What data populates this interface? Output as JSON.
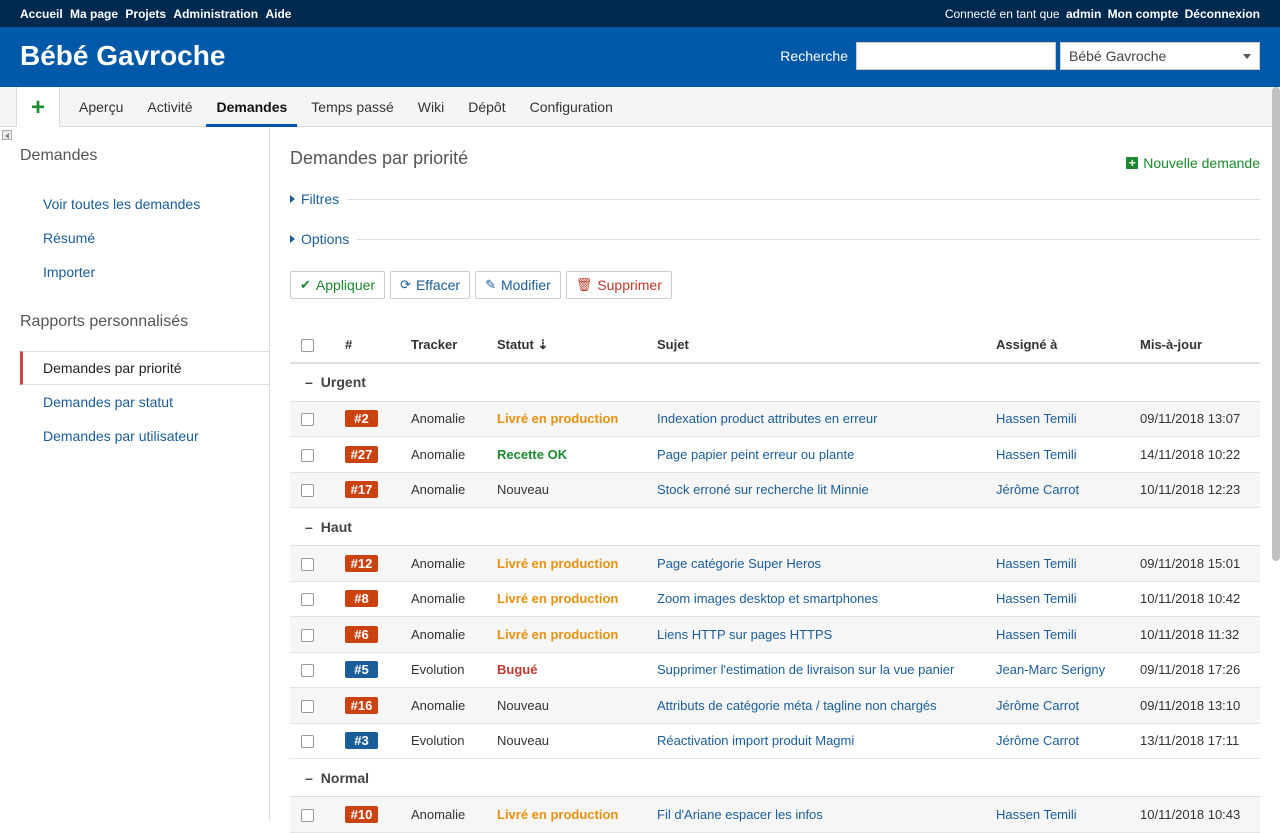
{
  "top_menu": {
    "links": [
      "Accueil",
      "Ma page",
      "Projets",
      "Administration",
      "Aide"
    ],
    "logged_as_label": "Connecté en tant que",
    "user": "admin",
    "account": "Mon compte",
    "logout": "Déconnexion"
  },
  "header": {
    "title": "Bébé Gavroche",
    "search_label": "Recherche",
    "search_value": "",
    "project_select": "Bébé Gavroche"
  },
  "main_menu": {
    "new_label": "+",
    "tabs": [
      "Aperçu",
      "Activité",
      "Demandes",
      "Temps passé",
      "Wiki",
      "Dépôt",
      "Configuration"
    ],
    "selected": "Demandes"
  },
  "sidebar": {
    "title": "Demandes",
    "links": [
      "Voir toutes les demandes",
      "Résumé",
      "Importer"
    ],
    "reports_title": "Rapports personnalisés",
    "queries": [
      "Demandes par priorité",
      "Demandes par statut",
      "Demandes par utilisateur"
    ],
    "active_query": "Demandes par priorité"
  },
  "content": {
    "title": "Demandes par priorité",
    "new_issue": "Nouvelle demande",
    "filters": "Filtres",
    "options": "Options",
    "buttons": {
      "apply": "Appliquer",
      "clear": "Effacer",
      "modify": "Modifier",
      "delete": "Supprimer"
    }
  },
  "table": {
    "columns": [
      "#",
      "Tracker",
      "Statut",
      "Sujet",
      "Assigné à",
      "Mis-à-jour"
    ],
    "groups": [
      {
        "name": "Urgent",
        "rows": [
          {
            "id": "#2",
            "tracker": "Anomalie",
            "status": "Livré en production",
            "subject": "Indexation product attributes en erreur",
            "assigned": "Hassen Temili",
            "updated": "09/11/2018 13:07"
          },
          {
            "id": "#27",
            "tracker": "Anomalie",
            "status": "Recette OK",
            "subject": "Page papier peint erreur ou plante",
            "assigned": "Hassen Temili",
            "updated": "14/11/2018 10:22"
          },
          {
            "id": "#17",
            "tracker": "Anomalie",
            "status": "Nouveau",
            "subject": "Stock erroné sur recherche lit Minnie",
            "assigned": "Jérôme Carrot",
            "updated": "10/11/2018 12:23"
          }
        ]
      },
      {
        "name": "Haut",
        "rows": [
          {
            "id": "#12",
            "tracker": "Anomalie",
            "status": "Livré en production",
            "subject": "Page catégorie Super Heros",
            "assigned": "Hassen Temili",
            "updated": "09/11/2018 15:01"
          },
          {
            "id": "#8",
            "tracker": "Anomalie",
            "status": "Livré en production",
            "subject": "Zoom images desktop et smartphones",
            "assigned": "Hassen Temili",
            "updated": "10/11/2018 10:42"
          },
          {
            "id": "#6",
            "tracker": "Anomalie",
            "status": "Livré en production",
            "subject": "Liens HTTP sur pages HTTPS",
            "assigned": "Hassen Temili",
            "updated": "10/11/2018 11:32"
          },
          {
            "id": "#5",
            "tracker": "Evolution",
            "status": "Bugué",
            "subject": "Supprimer l'estimation de livraison sur la vue panier",
            "assigned": "Jean-Marc Serigny",
            "updated": "09/11/2018 17:26"
          },
          {
            "id": "#16",
            "tracker": "Anomalie",
            "status": "Nouveau",
            "subject": "Attributs de catégorie méta / tagline non chargés",
            "assigned": "Jérôme Carrot",
            "updated": "09/11/2018 13:10"
          },
          {
            "id": "#3",
            "tracker": "Evolution",
            "status": "Nouveau",
            "subject": "Réactivation import produit Magmi",
            "assigned": "Jérôme Carrot",
            "updated": "13/11/2018 17:11"
          }
        ]
      },
      {
        "name": "Normal",
        "rows": [
          {
            "id": "#10",
            "tracker": "Anomalie",
            "status": "Livré en production",
            "subject": "Fil d'Ariane espacer les infos",
            "assigned": "Hassen Temili",
            "updated": "10/11/2018 10:43"
          }
        ]
      }
    ]
  },
  "colors": {
    "top_bar": "#00294f",
    "header": "#0059a8",
    "link": "#1a5d99",
    "anomalie_badge": "#c9420f",
    "evolution_badge": "#1a5d99",
    "status_livre": "#e8910f",
    "status_recette": "#1b8a2e",
    "status_bugue": "#c0392b"
  }
}
